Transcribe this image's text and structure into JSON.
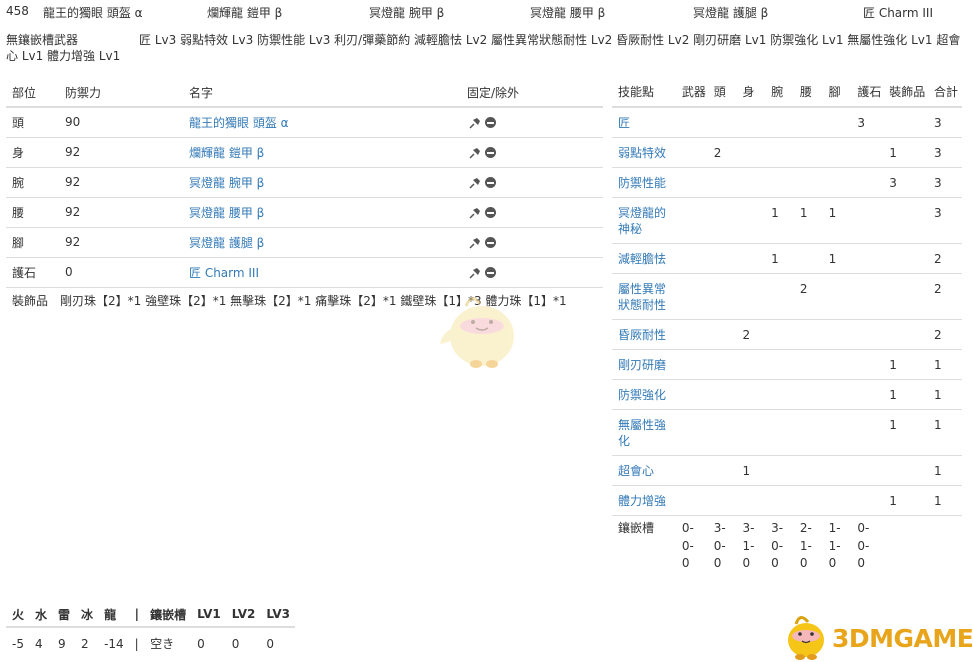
{
  "header": {
    "set_number": "458",
    "pieces": [
      {
        "label": "龍王的獨眼 頭盔 α"
      },
      {
        "label": "爛輝龍 鎧甲 β"
      },
      {
        "label": "冥燈龍 腕甲 β"
      },
      {
        "label": "冥燈龍 腰甲 β"
      },
      {
        "label": "冥燈龍 護腿 β"
      },
      {
        "label": "匠 Charm III"
      }
    ],
    "weapon_label": "無鑲嵌槽武器",
    "skills_text": "匠 Lv3 弱點特效 Lv3 防禦性能 Lv3 利刃/彈藥節約 減輕膽怯 Lv2 屬性異常狀態耐性 Lv2 昏厥耐性 Lv2 剛刃研磨 Lv1 防禦強化 Lv1 無屬性強化 Lv1 超會心 Lv1 體力增強 Lv1"
  },
  "armor_table": {
    "columns": {
      "part": "部位",
      "defense": "防禦力",
      "name": "名字",
      "fix": "固定/除外"
    },
    "rows": [
      {
        "part": "頭",
        "defense": "90",
        "name": "龍王的獨眼 頭盔 α"
      },
      {
        "part": "身",
        "defense": "92",
        "name": "爛輝龍 鎧甲 β"
      },
      {
        "part": "腕",
        "defense": "92",
        "name": "冥燈龍 腕甲 β"
      },
      {
        "part": "腰",
        "defense": "92",
        "name": "冥燈龍 腰甲 β"
      },
      {
        "part": "腳",
        "defense": "92",
        "name": "冥燈龍 護腿 β"
      },
      {
        "part": "護石",
        "defense": "0",
        "name": "匠 Charm III"
      }
    ],
    "decorations_label": "裝飾品",
    "decorations_text": "剛刃珠【2】*1 強壁珠【2】*1 無擊珠【2】*1 痛擊珠【2】*1 鐵壁珠【1】*3 體力珠【1】*1"
  },
  "skill_table": {
    "columns": [
      "技能點",
      "武器",
      "頭",
      "身",
      "腕",
      "腰",
      "腳",
      "護石",
      "裝飾品",
      "合計"
    ],
    "rows": [
      {
        "name": "匠",
        "cells": [
          "",
          "",
          "",
          "",
          "",
          "",
          "3",
          "",
          "3"
        ]
      },
      {
        "name": "弱點特效",
        "cells": [
          "",
          "2",
          "",
          "",
          "",
          "",
          "",
          "1",
          "3"
        ]
      },
      {
        "name": "防禦性能",
        "cells": [
          "",
          "",
          "",
          "",
          "",
          "",
          "",
          "3",
          "3"
        ]
      },
      {
        "name": "冥燈龍的神秘",
        "cells": [
          "",
          "",
          "",
          "1",
          "1",
          "1",
          "",
          "",
          "3"
        ]
      },
      {
        "name": "減輕膽怯",
        "cells": [
          "",
          "",
          "",
          "1",
          "",
          "1",
          "",
          "",
          "2"
        ]
      },
      {
        "name": "屬性異常狀態耐性",
        "cells": [
          "",
          "",
          "",
          "",
          "2",
          "",
          "",
          "",
          "2"
        ]
      },
      {
        "name": "昏厥耐性",
        "cells": [
          "",
          "",
          "2",
          "",
          "",
          "",
          "",
          "",
          "2"
        ]
      },
      {
        "name": "剛刃研磨",
        "cells": [
          "",
          "",
          "",
          "",
          "",
          "",
          "",
          "1",
          "1"
        ]
      },
      {
        "name": "防禦強化",
        "cells": [
          "",
          "",
          "",
          "",
          "",
          "",
          "",
          "1",
          "1"
        ]
      },
      {
        "name": "無屬性強化",
        "cells": [
          "",
          "",
          "",
          "",
          "",
          "",
          "",
          "1",
          "1"
        ]
      },
      {
        "name": "超會心",
        "cells": [
          "",
          "",
          "1",
          "",
          "",
          "",
          "",
          "",
          "1"
        ]
      },
      {
        "name": "體力增強",
        "cells": [
          "",
          "",
          "",
          "",
          "",
          "",
          "",
          "1",
          "1"
        ]
      }
    ],
    "slots_label": "鑲嵌槽",
    "slots": [
      "0-0-0",
      "3-0-0",
      "3-1-0",
      "3-0-0",
      "2-1-0",
      "1-1-0",
      "0-0-0"
    ]
  },
  "resistance_table": {
    "columns": [
      "火",
      "水",
      "雷",
      "冰",
      "龍",
      "|",
      "鑲嵌槽",
      "LV1",
      "LV2",
      "LV3"
    ],
    "values": [
      "-5",
      "4",
      "9",
      "2",
      "-14",
      "|",
      "空き",
      "0",
      "0",
      "0"
    ]
  },
  "watermark": {
    "text": "3DMGAME",
    "color": "#e8a51b"
  }
}
